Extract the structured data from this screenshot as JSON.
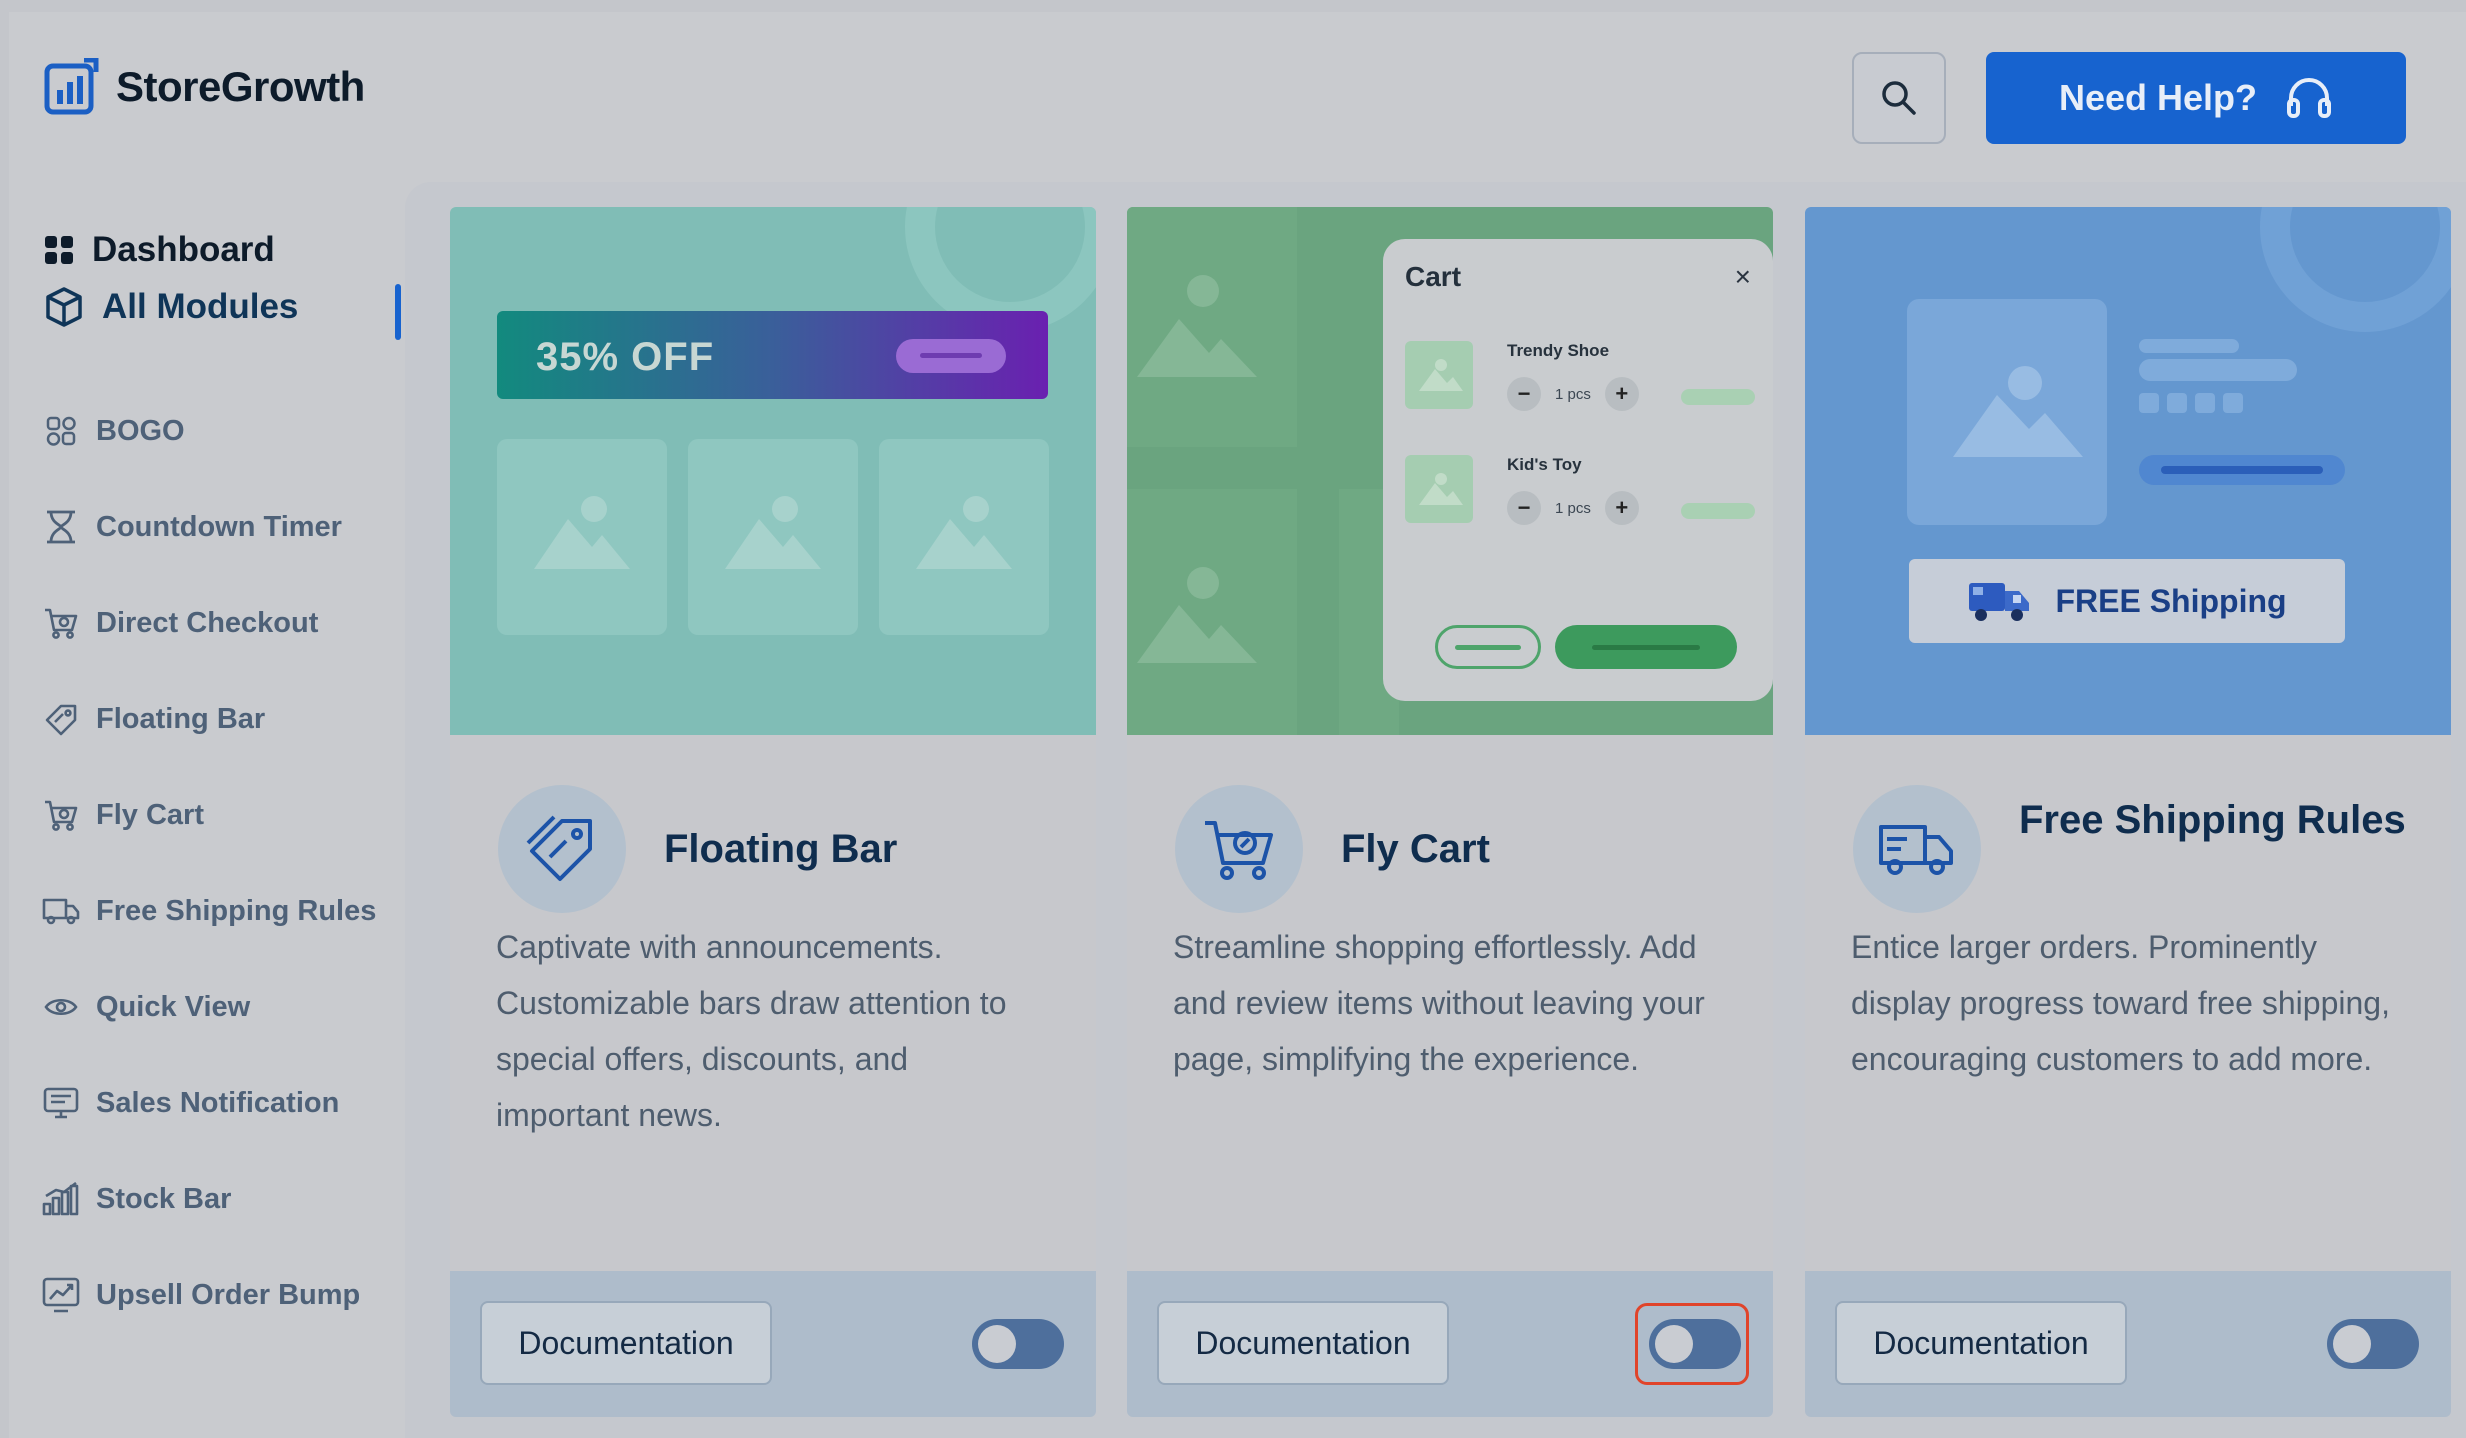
{
  "app": {
    "name": "StoreGrowth"
  },
  "header": {
    "help_label": "Need Help?"
  },
  "sidebar": {
    "dashboard": "Dashboard",
    "all_modules": "All Modules",
    "items": [
      {
        "label": "BOGO",
        "icon": "bogo-icon"
      },
      {
        "label": "Countdown Timer",
        "icon": "hourglass-icon"
      },
      {
        "label": "Direct Checkout",
        "icon": "cart-icon"
      },
      {
        "label": "Floating Bar",
        "icon": "tag-icon"
      },
      {
        "label": "Fly Cart",
        "icon": "cart-icon"
      },
      {
        "label": "Free Shipping Rules",
        "icon": "truck-icon"
      },
      {
        "label": "Quick View",
        "icon": "eye-icon"
      },
      {
        "label": "Sales Notification",
        "icon": "notification-icon"
      },
      {
        "label": "Stock Bar",
        "icon": "bar-chart-icon"
      },
      {
        "label": "Upsell Order Bump",
        "icon": "trend-icon"
      }
    ]
  },
  "cards": [
    {
      "title": "Floating Bar",
      "description": "Captivate with announcements. Customizable bars draw attention to special offers, discounts, and important news.",
      "doc_label": "Documentation",
      "enabled": false,
      "preview": {
        "banner_text": "35% OFF"
      }
    },
    {
      "title": "Fly Cart",
      "description": "Streamline shopping effortlessly. Add and review items without leaving your page, simplifying the experience.",
      "doc_label": "Documentation",
      "enabled": false,
      "preview": {
        "cart_title": "Cart",
        "close": "×",
        "items": [
          {
            "name": "Trendy Shoe",
            "qty": "1 pcs"
          },
          {
            "name": "Kid's Toy",
            "qty": "1 pcs"
          }
        ]
      }
    },
    {
      "title": "Free Shipping Rules",
      "description": "Entice larger orders. Prominently display progress toward free shipping, encouraging customers to add more.",
      "doc_label": "Documentation",
      "enabled": false,
      "preview": {
        "badge_text": "FREE Shipping"
      }
    }
  ],
  "colors": {
    "accent": "#1763cf",
    "toggle_off": "#4e6f9c",
    "focus_ring": "#e0442a",
    "card1_bg": "#80bdb6",
    "card2_bg": "#6aa47f",
    "card3_bg": "#6497cf"
  }
}
